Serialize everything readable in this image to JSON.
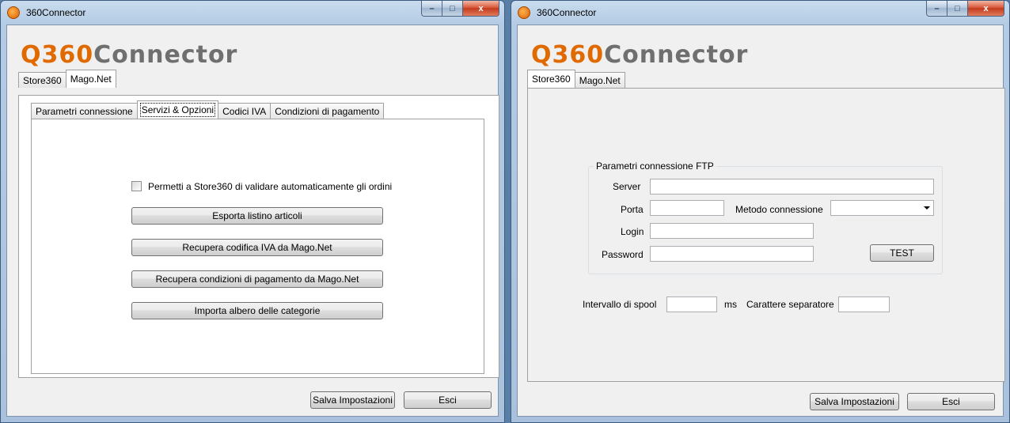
{
  "left_window": {
    "title": "360Connector",
    "caption": {
      "minimize": "–",
      "maximize": "□",
      "close": "x"
    },
    "logo": {
      "mark": "Q360",
      "word": "Connector"
    },
    "outer_tabs": [
      {
        "label": "Store360",
        "active": false
      },
      {
        "label": "Mago.Net",
        "active": true
      }
    ],
    "inner_tabs": [
      {
        "label": "Parametri connessione",
        "active": false
      },
      {
        "label": "Servizi & Opzioni",
        "active": true
      },
      {
        "label": "Codici IVA",
        "active": false
      },
      {
        "label": "Condizioni di pagamento",
        "active": false
      }
    ],
    "checkbox_label": "Permetti a Store360 di validare automaticamente gli ordini",
    "checkbox_checked": false,
    "actions": {
      "export": "Esporta listino articoli",
      "iva": "Recupera codifica IVA da Mago.Net",
      "payment": "Recupera condizioni di pagamento da Mago.Net",
      "categories": "Importa albero delle categorie"
    },
    "footer": {
      "save": "Salva Impostazioni",
      "exit": "Esci"
    }
  },
  "right_window": {
    "title": "360Connector",
    "caption": {
      "minimize": "–",
      "maximize": "□",
      "close": "x"
    },
    "logo": {
      "mark": "Q360",
      "word": "Connector"
    },
    "outer_tabs": [
      {
        "label": "Store360",
        "active": true
      },
      {
        "label": "Mago.Net",
        "active": false
      }
    ],
    "ftp": {
      "title": "Parametri connessione FTP",
      "server_label": "Server",
      "server_value": "",
      "port_label": "Porta",
      "port_value": "",
      "method_label": "Metodo connessione",
      "method_value": "",
      "login_label": "Login",
      "login_value": "",
      "password_label": "Password",
      "password_value": "",
      "test_button": "TEST"
    },
    "spool_label": "Intervallo di spool",
    "spool_value": "",
    "spool_unit": "ms",
    "separator_label": "Carattere separatore",
    "separator_value": "",
    "footer": {
      "save": "Salva Impostazioni",
      "exit": "Esci"
    }
  }
}
